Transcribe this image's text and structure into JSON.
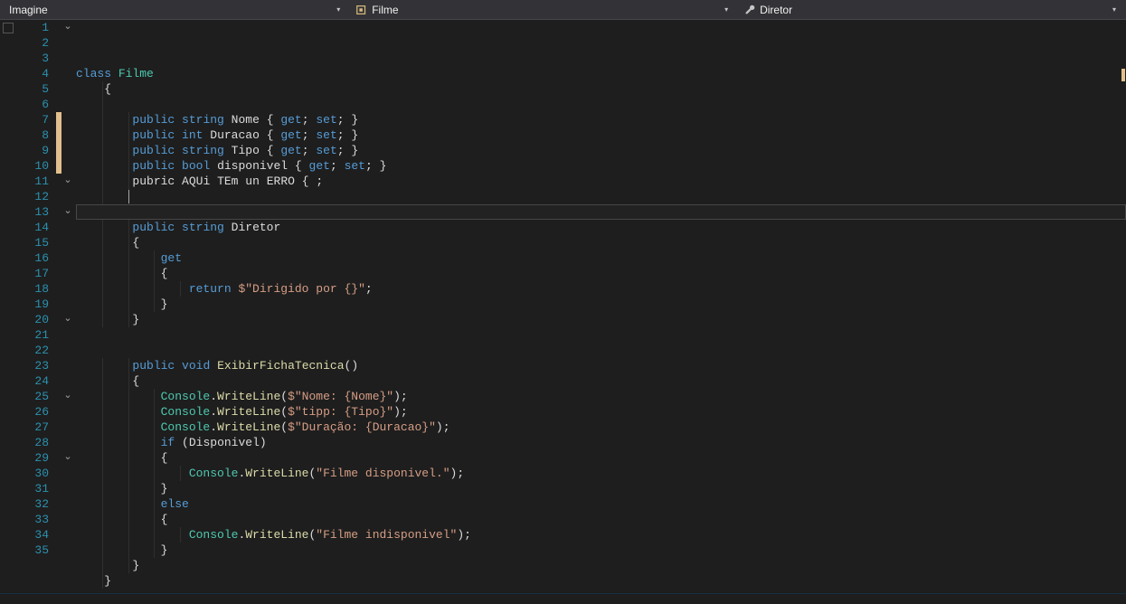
{
  "breadcrumbs": {
    "namespace": "Imagine",
    "class": "Filme",
    "member": "Diretor"
  },
  "lines": [
    {
      "n": 1,
      "fold": "open",
      "change": "",
      "html": "<span class='kw'>class</span> <span class='classn'>Filme</span>"
    },
    {
      "n": 2,
      "fold": "",
      "change": "",
      "html": "<span class='brace'>{</span>",
      "indent": 1
    },
    {
      "n": 3,
      "fold": "",
      "change": "",
      "html": "",
      "indent": 1
    },
    {
      "n": 4,
      "fold": "",
      "change": "",
      "html": "<span class='kw'>public</span> <span class='kw'>string</span> <span class='ident'>Nome</span> <span class='brace'>{</span> <span class='kw'>get</span><span class='punct'>;</span> <span class='kw'>set</span><span class='punct'>;</span> <span class='brace'>}</span>",
      "indent": 2
    },
    {
      "n": 5,
      "fold": "",
      "change": "",
      "html": "<span class='kw'>public</span> <span class='kw'>int</span> <span class='ident'>Duracao</span> <span class='brace'>{</span> <span class='kw'>get</span><span class='punct'>;</span> <span class='kw'>set</span><span class='punct'>;</span> <span class='brace'>}</span>",
      "indent": 2
    },
    {
      "n": 6,
      "fold": "",
      "change": "",
      "html": "<span class='kw'>public</span> <span class='kw'>string</span> <span class='ident'>Tipo</span> <span class='brace'>{</span> <span class='kw'>get</span><span class='punct'>;</span> <span class='kw'>set</span><span class='punct'>;</span> <span class='brace'>}</span>",
      "indent": 2
    },
    {
      "n": 7,
      "fold": "",
      "change": "mod",
      "html": "<span class='kw'>public</span> <span class='kw'>bool</span> <span class='ident'>disponivel</span> <span class='brace'>{</span> <span class='kw'>get</span><span class='punct'>;</span> <span class='kw'>set</span><span class='punct'>;</span> <span class='brace'>}</span>",
      "indent": 2
    },
    {
      "n": 8,
      "fold": "",
      "change": "mod",
      "html": "<span class='ident'>pubric</span> <span class='ident'>AQUi</span> <span class='ident'>TEm</span> <span class='ident'>un</span> <span class='ident'>ERRO</span> <span class='brace'>{</span> <span class='punct'>;</span>",
      "indent": 2
    },
    {
      "n": 9,
      "fold": "",
      "change": "mod",
      "html": "",
      "indent": 2,
      "current": true,
      "cursorCol": 8
    },
    {
      "n": 10,
      "fold": "",
      "change": "mod",
      "html": "",
      "indent": 0
    },
    {
      "n": 11,
      "fold": "open",
      "change": "",
      "html": "<span class='kw'>public</span> <span class='kw'>string</span> <span class='ident'>Diretor</span>",
      "indent": 2
    },
    {
      "n": 12,
      "fold": "",
      "change": "",
      "html": "<span class='brace'>{</span>",
      "indent": 2
    },
    {
      "n": 13,
      "fold": "open",
      "change": "",
      "html": "<span class='kw'>get</span>",
      "indent": 3
    },
    {
      "n": 14,
      "fold": "",
      "change": "",
      "html": "<span class='brace'>{</span>",
      "indent": 3
    },
    {
      "n": 15,
      "fold": "",
      "change": "",
      "html": "<span class='kw'>return</span> <span class='str'>$\"Dirigido por {}\"</span><span class='punct'>;</span>",
      "indent": 4
    },
    {
      "n": 16,
      "fold": "",
      "change": "",
      "html": "<span class='brace'>}</span>",
      "indent": 3
    },
    {
      "n": 17,
      "fold": "",
      "change": "",
      "html": "<span class='brace'>}</span>",
      "indent": 2
    },
    {
      "n": 18,
      "fold": "",
      "change": "",
      "html": "",
      "indent": 0
    },
    {
      "n": 19,
      "fold": "",
      "change": "",
      "html": "",
      "indent": 0
    },
    {
      "n": 20,
      "fold": "open",
      "change": "",
      "html": "<span class='kw'>public</span> <span class='kw'>void</span> <span class='method'>ExibirFichaTecnica</span><span class='punct'>()</span>",
      "indent": 2
    },
    {
      "n": 21,
      "fold": "",
      "change": "",
      "html": "<span class='brace'>{</span>",
      "indent": 2
    },
    {
      "n": 22,
      "fold": "",
      "change": "",
      "html": "<span class='type'>Console</span><span class='punct'>.</span><span class='method'>WriteLine</span><span class='punct'>(</span><span class='str'>$\"Nome: {Nome}\"</span><span class='punct'>);</span>",
      "indent": 3
    },
    {
      "n": 23,
      "fold": "",
      "change": "",
      "html": "<span class='type'>Console</span><span class='punct'>.</span><span class='method'>WriteLine</span><span class='punct'>(</span><span class='str'>$\"tipp: {Tipo}\"</span><span class='punct'>);</span>",
      "indent": 3
    },
    {
      "n": 24,
      "fold": "",
      "change": "",
      "html": "<span class='type'>Console</span><span class='punct'>.</span><span class='method'>WriteLine</span><span class='punct'>(</span><span class='str'>$\"Duração: {Duracao}\"</span><span class='punct'>);</span>",
      "indent": 3
    },
    {
      "n": 25,
      "fold": "open",
      "change": "",
      "html": "<span class='kw'>if</span> <span class='punct'>(</span><span class='ident'>Disponivel</span><span class='punct'>)</span>",
      "indent": 3
    },
    {
      "n": 26,
      "fold": "",
      "change": "",
      "html": "<span class='brace'>{</span>",
      "indent": 3
    },
    {
      "n": 27,
      "fold": "",
      "change": "",
      "html": "<span class='type'>Console</span><span class='punct'>.</span><span class='method'>WriteLine</span><span class='punct'>(</span><span class='str'>\"Filme disponivel.\"</span><span class='punct'>);</span>",
      "indent": 4
    },
    {
      "n": 28,
      "fold": "",
      "change": "",
      "html": "<span class='brace'>}</span>",
      "indent": 3
    },
    {
      "n": 29,
      "fold": "open",
      "change": "",
      "html": "<span class='kw'>else</span>",
      "indent": 3
    },
    {
      "n": 30,
      "fold": "",
      "change": "",
      "html": "<span class='brace'>{</span>",
      "indent": 3
    },
    {
      "n": 31,
      "fold": "",
      "change": "",
      "html": "<span class='type'>Console</span><span class='punct'>.</span><span class='method'>WriteLine</span><span class='punct'>(</span><span class='str'>\"Filme indisponivel\"</span><span class='punct'>);</span>",
      "indent": 4
    },
    {
      "n": 32,
      "fold": "",
      "change": "",
      "html": "<span class='brace'>}</span>",
      "indent": 3
    },
    {
      "n": 33,
      "fold": "",
      "change": "",
      "html": "<span class='brace'>}</span>",
      "indent": 2
    },
    {
      "n": 34,
      "fold": "",
      "change": "",
      "html": "<span class='brace'>}</span>",
      "indent": 1
    },
    {
      "n": 35,
      "fold": "",
      "change": "",
      "html": "",
      "indent": 0
    }
  ]
}
